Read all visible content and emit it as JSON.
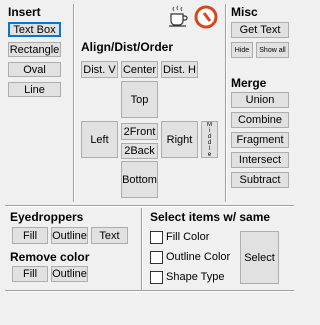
{
  "insert": {
    "title": "Insert",
    "text_box": "Text Box",
    "rectangle": "Rectangle",
    "oval": "Oval",
    "line": "Line"
  },
  "icons": {
    "coffee": "coffee-icon",
    "no_entry": "cancel-icon"
  },
  "align": {
    "title": "Align/Dist/Order",
    "dist_v": "Dist. V",
    "center": "Center",
    "dist_h": "Dist. H",
    "top": "Top",
    "left": "Left",
    "front": "2Front",
    "back": "2Back",
    "right": "Right",
    "middle": "Middle",
    "bottom": "Bottom"
  },
  "misc": {
    "title": "Misc",
    "get_text": "Get Text",
    "hide": "Hide",
    "show_all": "Show all"
  },
  "merge": {
    "title": "Merge",
    "union": "Union",
    "combine": "Combine",
    "fragment": "Fragment",
    "intersect": "Intersect",
    "subtract": "Subtract"
  },
  "eyedroppers": {
    "title": "Eyedroppers",
    "fill": "Fill",
    "outline": "Outline",
    "text": "Text"
  },
  "remove_color": {
    "title": "Remove color",
    "fill": "Fill",
    "outline": "Outline"
  },
  "select_same": {
    "title": "Select items w/ same",
    "fill_color": "Fill Color",
    "outline_color": "Outline Color",
    "shape_type": "Shape Type",
    "select": "Select"
  },
  "colors": {
    "accent": "#0078d7",
    "icon_red": "#d9461d"
  }
}
